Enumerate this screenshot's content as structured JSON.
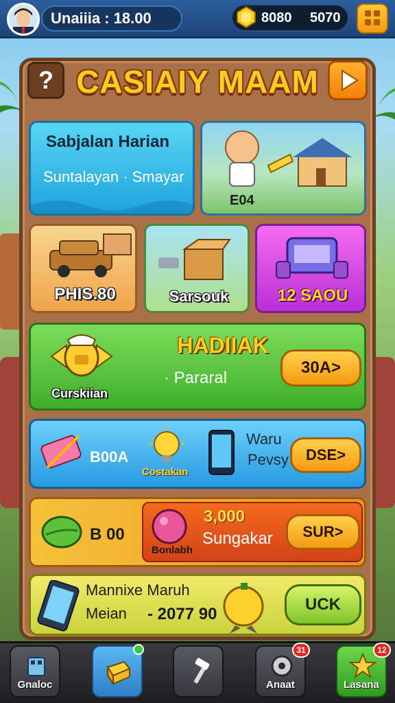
{
  "header": {
    "username": "Unaiiia : 18.00",
    "currency_a": "8080",
    "currency_b": "5070"
  },
  "title": "CASIAIY MAAM",
  "cards": {
    "daily": {
      "title": "Sabjalan Harian",
      "subtitle": "Suntalayan · Smayar"
    },
    "village": {
      "label": "E04"
    },
    "car": {
      "label": "PHIS.80"
    },
    "box": {
      "label": "Sarsouk"
    },
    "purple": {
      "label": "12 SAOU"
    },
    "gift": {
      "heading": "HADIIAK",
      "subtitle": "· Pararal",
      "caption": "Curskiian",
      "button": "30A>"
    },
    "blue": {
      "value": "B00A",
      "caption": "Costakan",
      "line1": "Waru",
      "line2": "Pevsy",
      "button": "DSE>"
    },
    "orange": {
      "value": "B 00",
      "caption": "Bonlabh",
      "amount": "3,000",
      "name": "Sungakar",
      "button": "SUR>"
    },
    "yellow": {
      "line1": "Mannixe Maruh",
      "line2": "Meian",
      "line3": "- 2077 90",
      "button": "UCK"
    }
  },
  "nav": [
    {
      "label": "Gnaloc",
      "icon": "building-icon"
    },
    {
      "label": "",
      "icon": "box-icon"
    },
    {
      "label": "",
      "icon": "hammer-icon"
    },
    {
      "label": "Anaat",
      "icon": "gear-icon",
      "badge": "31"
    },
    {
      "label": "Lasana",
      "icon": "star-icon",
      "badge": "12"
    }
  ],
  "colors": {
    "accent": "#ffcc22",
    "topbar": "#2c5f9e",
    "frame": "#a8714a"
  }
}
